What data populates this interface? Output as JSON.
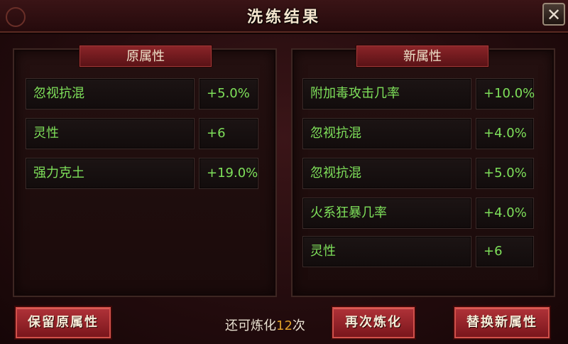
{
  "window": {
    "title": "洗练结果",
    "close_label": "✕"
  },
  "original": {
    "header": "原属性",
    "rows": [
      {
        "name": "忽视抗混",
        "value": "+5.0%"
      },
      {
        "name": "灵性",
        "value": "+6"
      },
      {
        "name": "强力克土",
        "value": "+19.0%"
      }
    ]
  },
  "new": {
    "header": "新属性",
    "rows": [
      {
        "name": "附加毒攻击几率",
        "value": "+10.0%"
      },
      {
        "name": "忽视抗混",
        "value": "+4.0%"
      },
      {
        "name": "忽视抗混",
        "value": "+5.0%"
      },
      {
        "name": "火系狂暴几率",
        "value": "+4.0%"
      },
      {
        "name": "灵性",
        "value": "+6"
      }
    ]
  },
  "footer": {
    "keep_label": "保留原属性",
    "refine_prefix": "还可炼化",
    "refine_count": "12",
    "refine_suffix": "次",
    "refine_again_label": "再次炼化",
    "replace_label": "替换新属性"
  },
  "colors": {
    "attr_text": "#7ee05a",
    "count_highlight": "#e0a02a",
    "button_red": "#b03238"
  }
}
